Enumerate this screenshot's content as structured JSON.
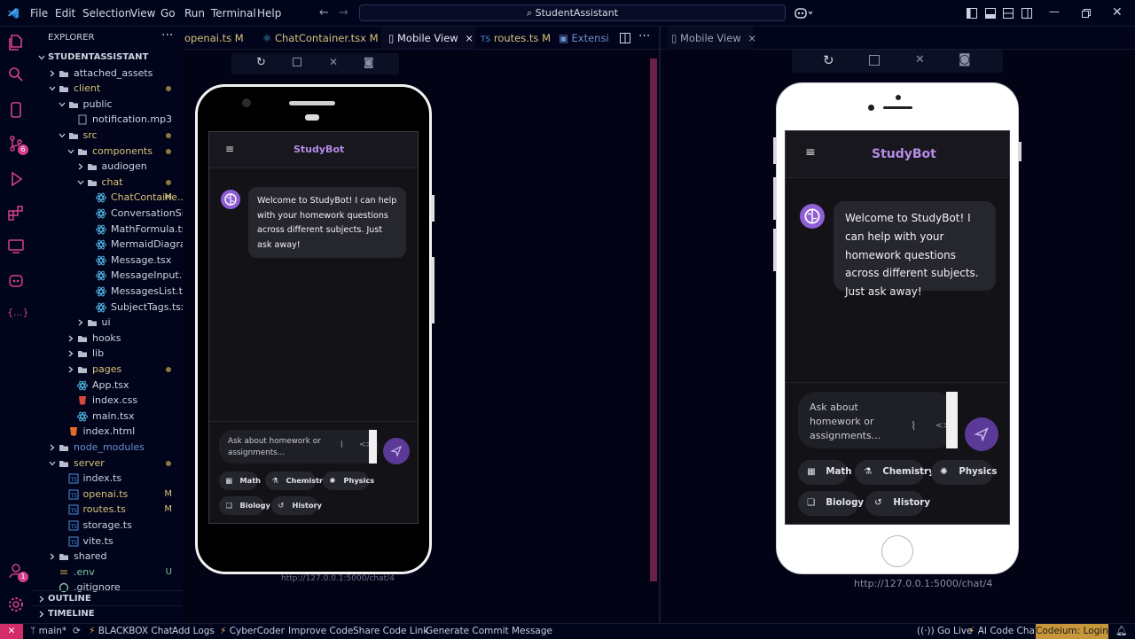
{
  "menu": [
    "File",
    "Edit",
    "Selection",
    "View",
    "Go",
    "Run",
    "Terminal",
    "Help"
  ],
  "search": {
    "text": "StudentAssistant"
  },
  "explorer": {
    "title": "EXPLORER",
    "root": "STUDENTASSISTANT",
    "items": [
      {
        "label": "attached_assets",
        "depth": 1,
        "type": "folder",
        "open": false,
        "color": "#cfd3e0"
      },
      {
        "label": "client",
        "depth": 1,
        "type": "folder",
        "open": true,
        "color": "#d9c27a",
        "dot": true
      },
      {
        "label": "public",
        "depth": 2,
        "type": "folder",
        "open": true,
        "color": "#cfd3e0"
      },
      {
        "label": "notification.mp3",
        "depth": 3,
        "type": "file",
        "color": "#cfd3e0"
      },
      {
        "label": "src",
        "depth": 2,
        "type": "folder",
        "open": true,
        "color": "#d9c27a",
        "dot": true
      },
      {
        "label": "components",
        "depth": 3,
        "type": "folder",
        "open": true,
        "color": "#d9c27a",
        "dot": true
      },
      {
        "label": "audiogen",
        "depth": 4,
        "type": "folder",
        "open": false,
        "color": "#cfd3e0"
      },
      {
        "label": "chat",
        "depth": 4,
        "type": "folder",
        "open": true,
        "color": "#d9c27a",
        "dot": true
      },
      {
        "label": "ChatContaine...",
        "depth": 5,
        "type": "react",
        "color": "#d9c27a",
        "badge": "M"
      },
      {
        "label": "ConversationSideb...",
        "depth": 5,
        "type": "react",
        "color": "#cfd3e0"
      },
      {
        "label": "MathFormula.tsx",
        "depth": 5,
        "type": "react",
        "color": "#cfd3e0"
      },
      {
        "label": "MermaidDiagram.tsx",
        "depth": 5,
        "type": "react",
        "color": "#cfd3e0"
      },
      {
        "label": "Message.tsx",
        "depth": 5,
        "type": "react",
        "color": "#cfd3e0"
      },
      {
        "label": "MessageInput.tsx",
        "depth": 5,
        "type": "react",
        "color": "#cfd3e0"
      },
      {
        "label": "MessagesList.tsx",
        "depth": 5,
        "type": "react",
        "color": "#cfd3e0"
      },
      {
        "label": "SubjectTags.tsx",
        "depth": 5,
        "type": "react",
        "color": "#cfd3e0"
      },
      {
        "label": "ui",
        "depth": 4,
        "type": "folder",
        "open": false,
        "color": "#cfd3e0"
      },
      {
        "label": "hooks",
        "depth": 3,
        "type": "folder",
        "open": false,
        "color": "#cfd3e0"
      },
      {
        "label": "lib",
        "depth": 3,
        "type": "folder",
        "open": false,
        "color": "#cfd3e0"
      },
      {
        "label": "pages",
        "depth": 3,
        "type": "folder",
        "open": false,
        "color": "#d9c27a",
        "dot": true
      },
      {
        "label": "App.tsx",
        "depth": 3,
        "type": "react",
        "color": "#cfd3e0"
      },
      {
        "label": "index.css",
        "depth": 3,
        "type": "css",
        "color": "#cfd3e0"
      },
      {
        "label": "main.tsx",
        "depth": 3,
        "type": "react",
        "color": "#cfd3e0"
      },
      {
        "label": "index.html",
        "depth": 2,
        "type": "html",
        "color": "#cfd3e0"
      },
      {
        "label": "node_modules",
        "depth": 1,
        "type": "folder",
        "open": false,
        "color": "#6b8fd1"
      },
      {
        "label": "server",
        "depth": 1,
        "type": "folder",
        "open": true,
        "color": "#d9c27a",
        "dot": true
      },
      {
        "label": "index.ts",
        "depth": 2,
        "type": "ts",
        "color": "#cfd3e0"
      },
      {
        "label": "openai.ts",
        "depth": 2,
        "type": "ts",
        "color": "#d9c27a",
        "badge": "M"
      },
      {
        "label": "routes.ts",
        "depth": 2,
        "type": "ts",
        "color": "#d9c27a",
        "badge": "M"
      },
      {
        "label": "storage.ts",
        "depth": 2,
        "type": "ts",
        "color": "#cfd3e0"
      },
      {
        "label": "vite.ts",
        "depth": 2,
        "type": "ts",
        "color": "#cfd3e0"
      },
      {
        "label": "shared",
        "depth": 1,
        "type": "folder",
        "open": false,
        "color": "#cfd3e0"
      },
      {
        "label": ".env",
        "depth": 1,
        "type": "env",
        "color": "#7fc6a4",
        "badge": "U"
      },
      {
        "label": ".gitignore",
        "depth": 1,
        "type": "git",
        "color": "#cfd3e0"
      }
    ],
    "outline": "OUTLINE",
    "timeline": "TIMELINE"
  },
  "tabs_left": [
    {
      "label": "openai.ts",
      "badge": "M"
    },
    {
      "label": "ChatContainer.tsx",
      "badge": "M"
    },
    {
      "label": "Mobile View",
      "badge": "×"
    },
    {
      "label": "routes.ts",
      "badge": "M"
    },
    {
      "label": "Extensi"
    }
  ],
  "tabs_right": [
    {
      "label": "Mobile View",
      "badge": "×"
    }
  ],
  "app": {
    "brand": "StudyBot",
    "welcome": "Welcome to StudyBot! I can help with your homework questions across different subjects. Just ask away!",
    "placeholder": "Ask about homework or assignments...",
    "chips": [
      "Math",
      "Chemistry",
      "Physics",
      "Biology",
      "History"
    ],
    "url": "http://127.0.0.1:5000/chat/4"
  },
  "statusbar": {
    "branch": "main*",
    "items": [
      "BLACKBOX Chat",
      "Add Logs",
      "CyberCoder",
      "Improve Code",
      "Share Code Link",
      "Generate Commit Message"
    ],
    "right": [
      "Go Live",
      "AI Code Chat"
    ],
    "login": "Codeium: Login"
  },
  "colors": {
    "accent": "#b78be8",
    "avatar": "#8e5fd6",
    "modified": "#d9c27a",
    "login_bg": "#c8963a"
  }
}
